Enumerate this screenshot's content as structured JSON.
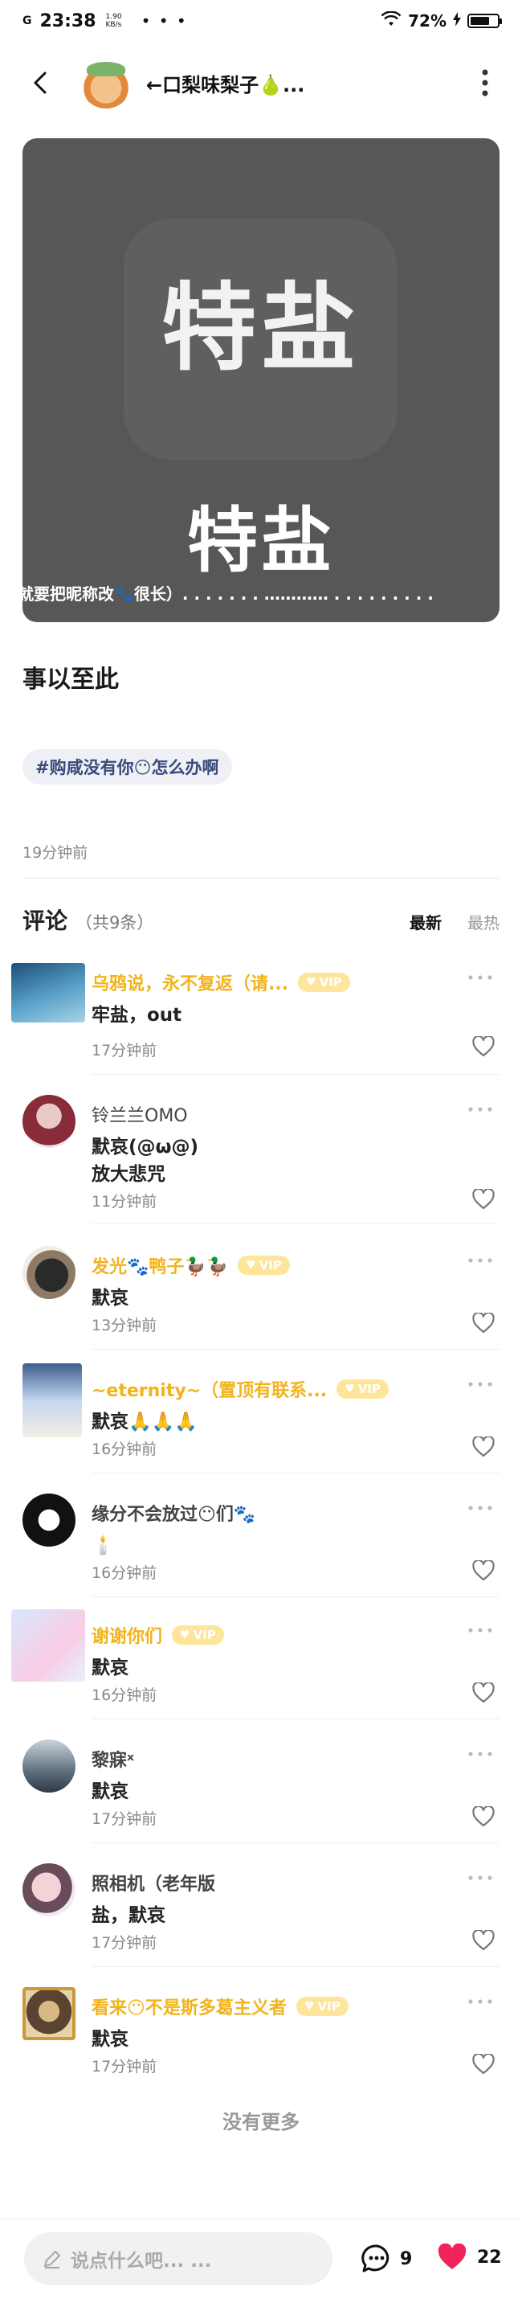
{
  "status_bar": {
    "signal": "G",
    "netspeed_value": "1.90",
    "netspeed_unit": "KB/s",
    "time": "23:38",
    "dots": "• • •",
    "battery": "72%",
    "battery_level": 0.72
  },
  "header": {
    "title": "←口梨味梨子🍐..."
  },
  "post": {
    "image_big_text": "特盐",
    "image_mid_text": "特盐",
    "image_caption": "就要把昵称改🐾很长）. . . . . . . ………… . . . . . . . . .",
    "title": "事以至此",
    "tag": "#购咸没有你😶怎么办啊",
    "time": "19分钟前"
  },
  "comments_header": {
    "title": "评论",
    "count": "（共9条）",
    "sort_new": "最新",
    "sort_hot": "最热"
  },
  "comments": [
    {
      "name": "乌鸦说，永不复返（请...",
      "vip": true,
      "vip_label": "VIP",
      "text": "牢盐，out",
      "time": "17分钟前"
    },
    {
      "name": "铃兰兰OMO",
      "vip": false,
      "text": "默哀(@ω@)",
      "text2": "放大悲咒",
      "time": "11分钟前"
    },
    {
      "name": "发光🐾鸭子🦆🦆",
      "vip": true,
      "vip_label": "VIP",
      "text": "默哀",
      "time": "13分钟前"
    },
    {
      "name": "~eternity~（置顶有联系...",
      "vip": true,
      "vip_label": "VIP",
      "text": "默哀🙏🙏🙏",
      "time": "16分钟前"
    },
    {
      "name": "缘分不会放过😶们🐾",
      "vip": false,
      "text": "🕯️",
      "time": "16分钟前"
    },
    {
      "name": "谢谢你们",
      "vip": true,
      "vip_label": "VIP",
      "text": "默哀",
      "time": "16分钟前"
    },
    {
      "name": "黎寐ˣ",
      "vip": false,
      "text": "默哀",
      "time": "17分钟前"
    },
    {
      "name": "照相机（老年版",
      "vip": false,
      "text": "盐，默哀",
      "time": "17分钟前"
    },
    {
      "name": "看来😶不是斯多葛主义者",
      "vip": true,
      "vip_label": "VIP",
      "text": "默哀",
      "time": "17分钟前"
    }
  ],
  "no_more": "没有更多",
  "bottom_bar": {
    "input_placeholder": "说点什么吧... ...",
    "comment_count": "9",
    "like_count": "22"
  }
}
